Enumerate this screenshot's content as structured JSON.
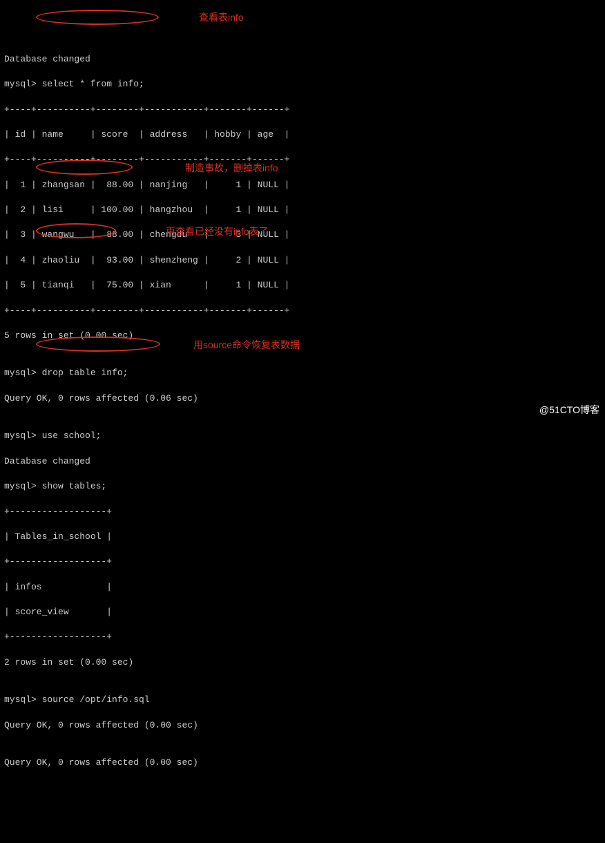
{
  "lines": {
    "l0": "Database changed",
    "l1": "mysql> select * from info;",
    "l2": "+----+----------+--------+-----------+-------+------+",
    "l3": "| id | name     | score  | address   | hobby | age  |",
    "l4": "+----+----------+--------+-----------+-------+------+",
    "l5": "|  1 | zhangsan |  88.00 | nanjing   |     1 | NULL |",
    "l6": "|  2 | lisi     | 100.00 | hangzhou  |     1 | NULL |",
    "l7": "|  3 | wangwu   |  88.00 | chengdu   |     3 | NULL |",
    "l8": "|  4 | zhaoliu  |  93.00 | shenzheng |     2 | NULL |",
    "l9": "|  5 | tianqi   |  75.00 | xian      |     1 | NULL |",
    "l10": "+----+----------+--------+-----------+-------+------+",
    "l11": "5 rows in set (0.00 sec)",
    "l12": "",
    "l13": "mysql> drop table info;",
    "l14": "Query OK, 0 rows affected (0.06 sec)",
    "l15": "",
    "l16": "mysql> use school;",
    "l17": "Database changed",
    "l18": "mysql> show tables;",
    "l19": "+------------------+",
    "l20": "| Tables_in_school |",
    "l21": "+------------------+",
    "l22": "| infos            |",
    "l23": "| score_view       |",
    "l24": "+------------------+",
    "l25": "2 rows in set (0.00 sec)",
    "l26": "",
    "l27": "mysql> source /opt/info.sql",
    "l28": "Query OK, 0 rows affected (0.00 sec)",
    "l29": "",
    "l30": "Query OK, 0 rows affected (0.00 sec)"
  },
  "annotations": {
    "a1": "查看表info",
    "a2": "制造事故，删掉表info",
    "a3": "再查看已经没有info表了",
    "a4": "用source命令恢复表数据"
  },
  "watermark": "@51CTO博客"
}
